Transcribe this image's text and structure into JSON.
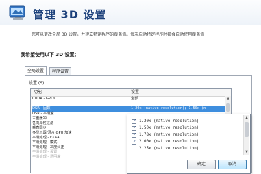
{
  "header": {
    "title": "管理 3D 设置",
    "icon": "nvidia-settings-icon"
  },
  "description": "您可以更改全局 3D 设置，并建立特定程序的覆盖值。每次启动特定程序时都会自动使用覆盖值",
  "section_title": "我希望使用以下 3D 设置：",
  "tabs": [
    {
      "label": "全局设置",
      "active": true
    },
    {
      "label": "程序设置",
      "active": false
    }
  ],
  "settings_label": "设置 (S):",
  "table": {
    "col_feature": "功能",
    "col_setting": "设置",
    "rows": [
      {
        "feature": "CUDA - GPUs",
        "value": "全部",
        "state": "normal"
      },
      {
        "feature": "DSR - 因数",
        "value": "1.20x (native resolution); 1.50x (n",
        "state": "selected"
      },
      {
        "feature": "DSR - 平滑度",
        "value": "",
        "state": "normal"
      },
      {
        "feature": "三重缓冲",
        "value": "",
        "state": "normal"
      },
      {
        "feature": "各向异性过滤",
        "value": "",
        "state": "normal"
      },
      {
        "feature": "垂直同步",
        "value": "",
        "state": "normal"
      },
      {
        "feature": "多显示器/混合 GPU 加速",
        "value": "",
        "state": "normal"
      },
      {
        "feature": "平滑处理 - FXAA",
        "value": "",
        "state": "normal"
      },
      {
        "feature": "平滑处理 - 模式",
        "value": "",
        "state": "normal"
      },
      {
        "feature": "平滑处理 - 灰度纠正",
        "value": "",
        "state": "normal"
      },
      {
        "feature": "平滑处理 - 设置",
        "value": "",
        "state": "disabled"
      },
      {
        "feature": "平滑处理 - 透明度",
        "value": "",
        "state": "disabled"
      }
    ]
  },
  "popup": {
    "options": [
      {
        "label": "1.20x (native resolution)",
        "checked": true
      },
      {
        "label": "1.50x (native resolution)",
        "checked": true
      },
      {
        "label": "1.78x (native resolution)",
        "checked": true
      },
      {
        "label": "2.00x (native resolution)",
        "checked": true
      },
      {
        "label": "2.25x (native resolution)",
        "checked": false
      }
    ],
    "ok_label": "确定",
    "cancel_label": "取消"
  },
  "colors": {
    "title": "#1a3f7a",
    "selection": "#3e8ede"
  }
}
